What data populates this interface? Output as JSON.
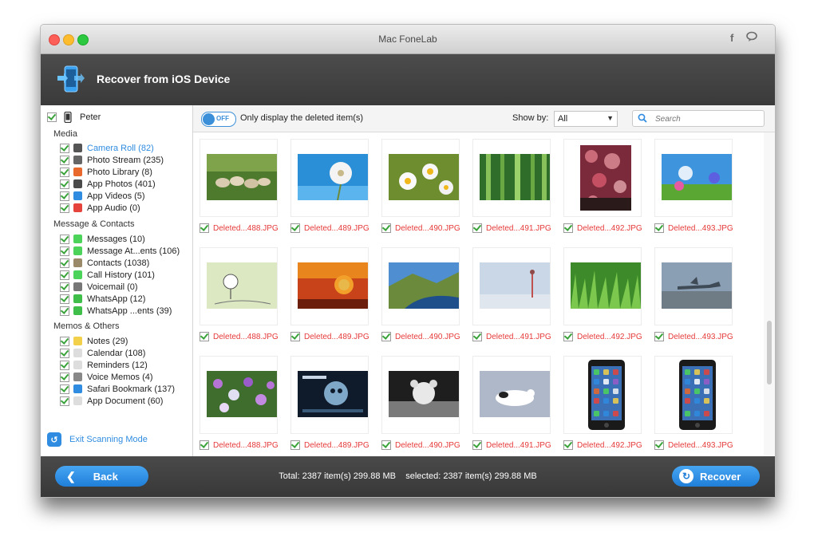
{
  "window": {
    "title": "Mac FoneLab"
  },
  "header": {
    "title": "Recover from iOS Device"
  },
  "sidebar": {
    "device": "Peter",
    "groups": [
      {
        "label": "Media",
        "items": [
          {
            "label": "Camera Roll (82)",
            "icon": "camera-icon",
            "color": "#555555",
            "selected": true
          },
          {
            "label": "Photo Stream (235)",
            "icon": "photo-stream-icon",
            "color": "#666666"
          },
          {
            "label": "Photo Library (8)",
            "icon": "photo-library-icon",
            "color": "#e8692b"
          },
          {
            "label": "App Photos (401)",
            "icon": "app-photos-icon",
            "color": "#4a4a4a"
          },
          {
            "label": "App Videos (5)",
            "icon": "app-videos-icon",
            "color": "#2f8ce0"
          },
          {
            "label": "App Audio (0)",
            "icon": "app-audio-icon",
            "color": "#e5443c"
          }
        ]
      },
      {
        "label": "Message & Contacts",
        "items": [
          {
            "label": "Messages (10)",
            "icon": "messages-icon",
            "color": "#4cd45a"
          },
          {
            "label": "Message At...ents (106)",
            "icon": "message-attachments-icon",
            "color": "#4cd45a"
          },
          {
            "label": "Contacts (1038)",
            "icon": "contacts-icon",
            "color": "#9a8a6a"
          },
          {
            "label": "Call History (101)",
            "icon": "call-history-icon",
            "color": "#4cd45a"
          },
          {
            "label": "Voicemail (0)",
            "icon": "voicemail-icon",
            "color": "#777777"
          },
          {
            "label": "WhatsApp (12)",
            "icon": "whatsapp-icon",
            "color": "#3fbf4a"
          },
          {
            "label": "WhatsApp ...ents (39)",
            "icon": "whatsapp-attachments-icon",
            "color": "#3fbf4a"
          }
        ]
      },
      {
        "label": "Memos & Others",
        "items": [
          {
            "label": "Notes (29)",
            "icon": "notes-icon",
            "color": "#f2d04a"
          },
          {
            "label": "Calendar (108)",
            "icon": "calendar-icon",
            "color": "#dddddd"
          },
          {
            "label": "Reminders (12)",
            "icon": "reminders-icon",
            "color": "#dddddd"
          },
          {
            "label": "Voice Memos (4)",
            "icon": "voice-memos-icon",
            "color": "#888888"
          },
          {
            "label": "Safari Bookmark (137)",
            "icon": "safari-icon",
            "color": "#2f8ce0"
          },
          {
            "label": "App Document (60)",
            "icon": "app-document-icon",
            "color": "#dddddd"
          }
        ]
      }
    ],
    "exit_label": "Exit Scanning Mode"
  },
  "filter": {
    "toggle_state": "OFF",
    "toggle_label": "Only display the deleted item(s)",
    "show_by_label": "Show by:",
    "show_by_value": "All",
    "search_placeholder": "Search"
  },
  "grid": {
    "rows": [
      [
        "Deleted...488.JPG",
        "Deleted...489.JPG",
        "Deleted...490.JPG",
        "Deleted...491.JPG",
        "Deleted...492.JPG",
        "Deleted...493.JPG"
      ],
      [
        "Deleted...488.JPG",
        "Deleted...489.JPG",
        "Deleted...490.JPG",
        "Deleted...491.JPG",
        "Deleted...492.JPG",
        "Deleted...493.JPG"
      ],
      [
        "Deleted...488.JPG",
        "Deleted...489.JPG",
        "Deleted...490.JPG",
        "Deleted...491.JPG",
        "Deleted...492.JPG",
        "Deleted...493.JPG"
      ]
    ],
    "thumbnails": [
      [
        "sheep-photo",
        "dandelion-photo",
        "daisies-photo",
        "bamboo-photo",
        "bokeh-photo",
        "flowers-sky-photo"
      ],
      [
        "cartoon-photo",
        "lion-sunset-photo",
        "landscape-photo",
        "figure-photo",
        "grass-photo",
        "jet-photo"
      ],
      [
        "wildflowers-photo",
        "movie-poster-photo",
        "teddy-bear-photo",
        "snoopy-photo",
        "iphone-screen-photo",
        "iphone-screen-photo"
      ]
    ]
  },
  "footer": {
    "back_label": "Back",
    "recover_label": "Recover",
    "total_text": "Total: 2387 item(s) 299.88 MB",
    "selected_text": "selected: 2387 item(s) 299.88 MB"
  },
  "colors": {
    "accent": "#2f8ce0",
    "deleted_text": "#e63a3a",
    "header_bg": "#424242"
  }
}
